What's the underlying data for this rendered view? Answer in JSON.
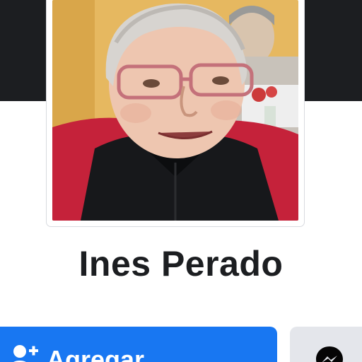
{
  "profile": {
    "name": "Ines Perado",
    "photo_icon": "profile-photo"
  },
  "actions": {
    "add_friend_label": "Agregar",
    "add_friend_icon": "add-person-icon",
    "message_icon": "messenger-icon"
  },
  "colors": {
    "cover": "#1c1e21",
    "primary_button": "#1877f2",
    "secondary_button": "#e4e6eb",
    "name_text": "#1c1e21"
  }
}
